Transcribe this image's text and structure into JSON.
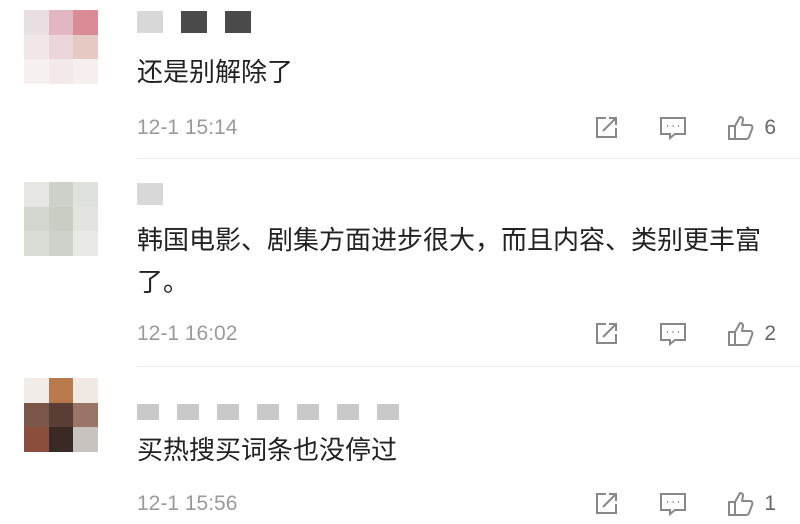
{
  "comments": [
    {
      "text": "还是别解除了",
      "time": "12-1 15:14",
      "likes": "6",
      "icons": [
        "share-icon",
        "comment-icon",
        "like-icon"
      ]
    },
    {
      "text": "韩国电影、剧集方面进步很大，而且内容、类别更丰富了。",
      "time": "12-1 16:02",
      "likes": "2",
      "icons": [
        "share-icon",
        "comment-icon",
        "like-icon"
      ]
    },
    {
      "text": "买热搜买词条也没停过",
      "time": "12-1 15:56",
      "likes": "1",
      "icons": [
        "share-icon",
        "comment-icon",
        "like-icon"
      ]
    }
  ],
  "colors": {
    "text": "#222222",
    "meta": "#9a9a9a",
    "icon": "#888888",
    "divider": "#ececec"
  }
}
